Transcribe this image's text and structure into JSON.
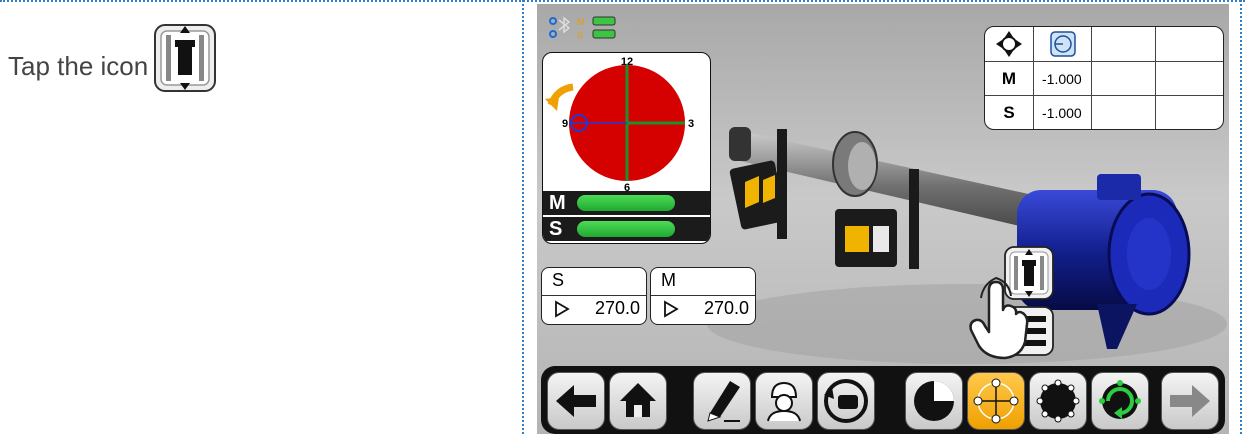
{
  "instruction": {
    "text": "Tap the icon",
    "icon": "vertical-alignment-icon"
  },
  "device": {
    "status": {
      "icons": [
        "bluetooth-icon",
        "battery-icon"
      ],
      "sensor_labels": [
        "M",
        "S"
      ]
    },
    "dial": {
      "labels": {
        "top": "12",
        "right": "3",
        "bottom": "6",
        "left": "9"
      },
      "color": "#d50000",
      "rotate_icon": "rotate-arrow-icon"
    },
    "level_bars": [
      {
        "label": "M"
      },
      {
        "label": "S"
      }
    ],
    "results_table": {
      "header_icons": [
        "crosshair-icon",
        "target-icon"
      ],
      "rows": [
        {
          "label": "M",
          "value": "-1.000"
        },
        {
          "label": "S",
          "value": "-1.000"
        }
      ]
    },
    "angles": [
      {
        "label": "S",
        "value": "270.0"
      },
      {
        "label": "M",
        "value": "270.0"
      }
    ],
    "floating_icons": [
      "vertical-alignment-icon",
      "horizontal-alignment-icon",
      "tap-hand-icon"
    ],
    "toolbar": {
      "buttons": [
        "back-arrow-icon",
        "home-icon",
        "edit-icon",
        "operator-icon",
        "machine-rotation-icon",
        "quadrant-icon",
        "crosshair-measure-icon",
        "multipoint-icon",
        "continuous-sweep-icon",
        "forward-arrow-icon"
      ]
    }
  }
}
